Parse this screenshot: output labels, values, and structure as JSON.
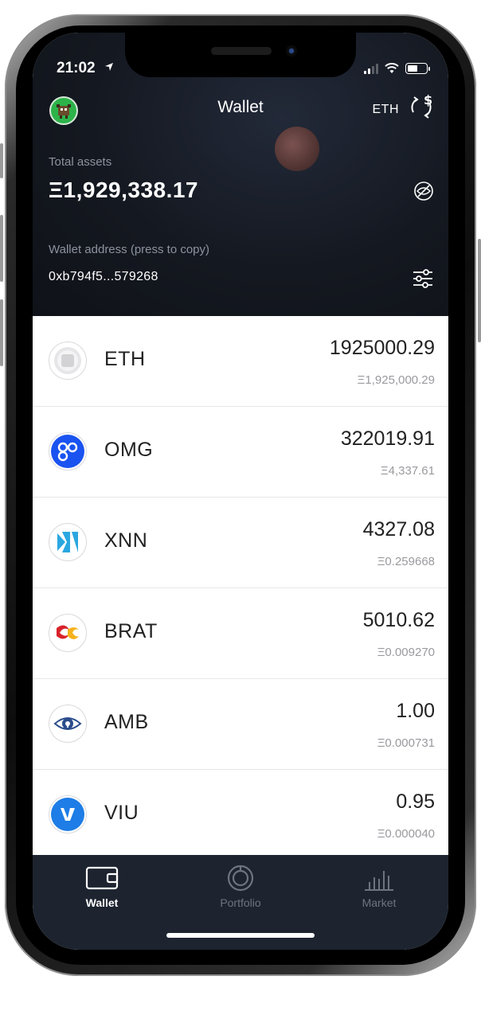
{
  "status_bar": {
    "time": "21:02"
  },
  "header": {
    "title": "Wallet",
    "currency": "ETH",
    "total_assets_label": "Total assets",
    "total_assets_value": "Ξ1,929,338.17",
    "wallet_address_label": "Wallet address (press to copy)",
    "wallet_address": "0xb794f5...579268"
  },
  "tokens": [
    {
      "symbol": "ETH",
      "amount": "1925000.29",
      "eth_value": "Ξ1,925,000.29",
      "icon": "eth-token-icon"
    },
    {
      "symbol": "OMG",
      "amount": "322019.91",
      "eth_value": "Ξ4,337.61",
      "icon": "omg-token-icon"
    },
    {
      "symbol": "XNN",
      "amount": "4327.08",
      "eth_value": "Ξ0.259668",
      "icon": "xnn-token-icon"
    },
    {
      "symbol": "BRAT",
      "amount": "5010.62",
      "eth_value": "Ξ0.009270",
      "icon": "brat-token-icon"
    },
    {
      "symbol": "AMB",
      "amount": "1.00",
      "eth_value": "Ξ0.000731",
      "icon": "amb-token-icon"
    },
    {
      "symbol": "VIU",
      "amount": "0.95",
      "eth_value": "Ξ0.000040",
      "icon": "viu-token-icon"
    }
  ],
  "tabbar": {
    "tabs": [
      {
        "label": "Wallet",
        "icon": "wallet-icon",
        "active": true
      },
      {
        "label": "Portfolio",
        "icon": "portfolio-icon",
        "active": false
      },
      {
        "label": "Market",
        "icon": "market-chart-icon",
        "active": false
      }
    ]
  },
  "colors": {
    "header_bg": "#141820",
    "tabbar_bg": "#1d2430",
    "text_primary": "#222222",
    "text_muted": "#9a9a9f"
  }
}
